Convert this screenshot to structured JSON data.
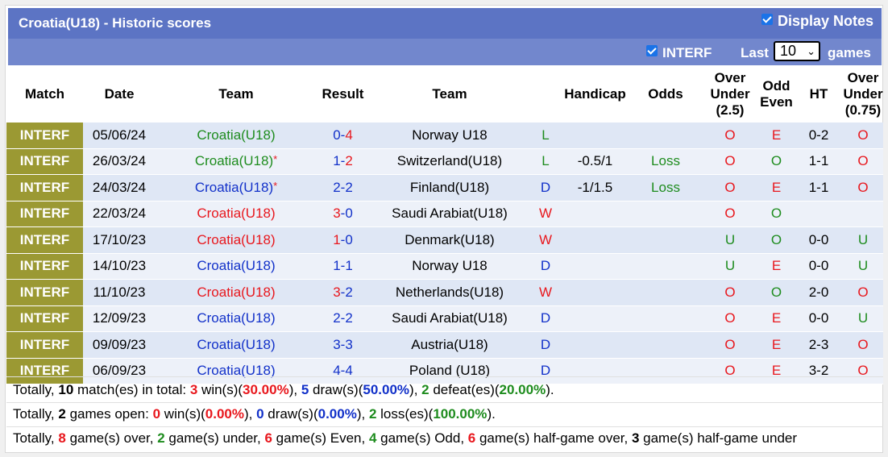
{
  "header": {
    "title": "Croatia(U18) - Historic scores",
    "display_notes_label": "Display Notes",
    "display_notes_checked": true
  },
  "filters": {
    "interf_label": "INTERF",
    "interf_checked": true,
    "last_label": "Last",
    "last_value": "10",
    "games_label": "games"
  },
  "columns": [
    "Match",
    "Date",
    "Team",
    "Result",
    "Team",
    "",
    "Handicap",
    "Odds",
    "Over Under (2.5)",
    "Odd Even",
    "HT",
    "Over Under (0.75)"
  ],
  "rows": [
    {
      "league": "INTERF",
      "date": "05/06/24",
      "home": "Croatia(U18)",
      "home_color": "green",
      "home_star": false,
      "score_h": "0",
      "score_a": "4",
      "h_color": "blue",
      "a_color": "red",
      "away": "Norway U18",
      "wld": "L",
      "wld_color": "green",
      "handicap": "",
      "odds": "",
      "ou": "O",
      "ou_color": "red",
      "oe": "E",
      "oe_color": "red",
      "ht": "0-2",
      "ou2": "O",
      "ou2_color": "red"
    },
    {
      "league": "INTERF",
      "date": "26/03/24",
      "home": "Croatia(U18)",
      "home_color": "green",
      "home_star": true,
      "score_h": "1",
      "score_a": "2",
      "h_color": "blue",
      "a_color": "red",
      "away": "Switzerland(U18)",
      "wld": "L",
      "wld_color": "green",
      "handicap": "-0.5/1",
      "odds": "Loss",
      "ou": "O",
      "ou_color": "red",
      "oe": "O",
      "oe_color": "green",
      "ht": "1-1",
      "ou2": "O",
      "ou2_color": "red"
    },
    {
      "league": "INTERF",
      "date": "24/03/24",
      "home": "Croatia(U18)",
      "home_color": "blue",
      "home_star": true,
      "score_h": "2",
      "score_a": "2",
      "h_color": "blue",
      "a_color": "blue",
      "away": "Finland(U18)",
      "wld": "D",
      "wld_color": "blue",
      "handicap": "-1/1.5",
      "odds": "Loss",
      "ou": "O",
      "ou_color": "red",
      "oe": "E",
      "oe_color": "red",
      "ht": "1-1",
      "ou2": "O",
      "ou2_color": "red"
    },
    {
      "league": "INTERF",
      "date": "22/03/24",
      "home": "Croatia(U18)",
      "home_color": "red",
      "home_star": false,
      "score_h": "3",
      "score_a": "0",
      "h_color": "red",
      "a_color": "blue",
      "away": "Saudi Arabiat(U18)",
      "wld": "W",
      "wld_color": "red",
      "handicap": "",
      "odds": "",
      "ou": "O",
      "ou_color": "red",
      "oe": "O",
      "oe_color": "green",
      "ht": "",
      "ou2": "",
      "ou2_color": "red"
    },
    {
      "league": "INTERF",
      "date": "17/10/23",
      "home": "Croatia(U18)",
      "home_color": "red",
      "home_star": false,
      "score_h": "1",
      "score_a": "0",
      "h_color": "red",
      "a_color": "blue",
      "away": "Denmark(U18)",
      "wld": "W",
      "wld_color": "red",
      "handicap": "",
      "odds": "",
      "ou": "U",
      "ou_color": "green",
      "oe": "O",
      "oe_color": "green",
      "ht": "0-0",
      "ou2": "U",
      "ou2_color": "green"
    },
    {
      "league": "INTERF",
      "date": "14/10/23",
      "home": "Croatia(U18)",
      "home_color": "blue",
      "home_star": false,
      "score_h": "1",
      "score_a": "1",
      "h_color": "blue",
      "a_color": "blue",
      "away": "Norway U18",
      "wld": "D",
      "wld_color": "blue",
      "handicap": "",
      "odds": "",
      "ou": "U",
      "ou_color": "green",
      "oe": "E",
      "oe_color": "red",
      "ht": "0-0",
      "ou2": "U",
      "ou2_color": "green"
    },
    {
      "league": "INTERF",
      "date": "11/10/23",
      "home": "Croatia(U18)",
      "home_color": "red",
      "home_star": false,
      "score_h": "3",
      "score_a": "2",
      "h_color": "red",
      "a_color": "blue",
      "away": "Netherlands(U18)",
      "wld": "W",
      "wld_color": "red",
      "handicap": "",
      "odds": "",
      "ou": "O",
      "ou_color": "red",
      "oe": "O",
      "oe_color": "green",
      "ht": "2-0",
      "ou2": "O",
      "ou2_color": "red"
    },
    {
      "league": "INTERF",
      "date": "12/09/23",
      "home": "Croatia(U18)",
      "home_color": "blue",
      "home_star": false,
      "score_h": "2",
      "score_a": "2",
      "h_color": "blue",
      "a_color": "blue",
      "away": "Saudi Arabiat(U18)",
      "wld": "D",
      "wld_color": "blue",
      "handicap": "",
      "odds": "",
      "ou": "O",
      "ou_color": "red",
      "oe": "E",
      "oe_color": "red",
      "ht": "0-0",
      "ou2": "U",
      "ou2_color": "green"
    },
    {
      "league": "INTERF",
      "date": "09/09/23",
      "home": "Croatia(U18)",
      "home_color": "blue",
      "home_star": false,
      "score_h": "3",
      "score_a": "3",
      "h_color": "blue",
      "a_color": "blue",
      "away": "Austria(U18)",
      "wld": "D",
      "wld_color": "blue",
      "handicap": "",
      "odds": "",
      "ou": "O",
      "ou_color": "red",
      "oe": "E",
      "oe_color": "red",
      "ht": "2-3",
      "ou2": "O",
      "ou2_color": "red"
    },
    {
      "league": "INTERF",
      "date": "06/09/23",
      "home": "Croatia(U18)",
      "home_color": "blue",
      "home_star": false,
      "score_h": "4",
      "score_a": "4",
      "h_color": "blue",
      "a_color": "blue",
      "away": "Poland (U18)",
      "wld": "D",
      "wld_color": "blue",
      "handicap": "",
      "odds": "",
      "ou": "O",
      "ou_color": "red",
      "oe": "E",
      "oe_color": "red",
      "ht": "3-2",
      "ou2": "O",
      "ou2_color": "red"
    }
  ],
  "summary": {
    "line1": {
      "p1": "Totally, ",
      "matches": "10",
      "p2": " match(es) in total: ",
      "wins": "3",
      "p3": " win(s)(",
      "win_pct": "30.00%",
      "p4": "), ",
      "draws": "5",
      "p5": " draw(s)(",
      "draw_pct": "50.00%",
      "p6": "), ",
      "defeats": "2",
      "p7": " defeat(es)(",
      "defeat_pct": "20.00%",
      "p8": ")."
    },
    "line2": {
      "p1": "Totally, ",
      "games": "2",
      "p2": " games open: ",
      "wins": "0",
      "p3": " win(s)(",
      "win_pct": "0.00%",
      "p4": "), ",
      "draws": "0",
      "p5": " draw(s)(",
      "draw_pct": "0.00%",
      "p6": "), ",
      "losses": "2",
      "p7": " loss(es)(",
      "loss_pct": "100.00%",
      "p8": ")."
    },
    "line3": {
      "p1": "Totally, ",
      "over": "8",
      "p2": " game(s) over, ",
      "under": "2",
      "p3": " game(s) under, ",
      "even": "6",
      "p4": " game(s) Even, ",
      "odd": "4",
      "p5": " game(s) Odd, ",
      "hg_over": "6",
      "p6": " game(s) half-game over, ",
      "hg_under": "3",
      "p7": " game(s) half-game under"
    }
  },
  "colors": {
    "red": "#e8171d",
    "blue": "#1231c9",
    "green": "#1e8c1e",
    "league_bg": "#9b9933",
    "header_bg": "#5c74c4",
    "filter_bg": "#7287cd"
  }
}
